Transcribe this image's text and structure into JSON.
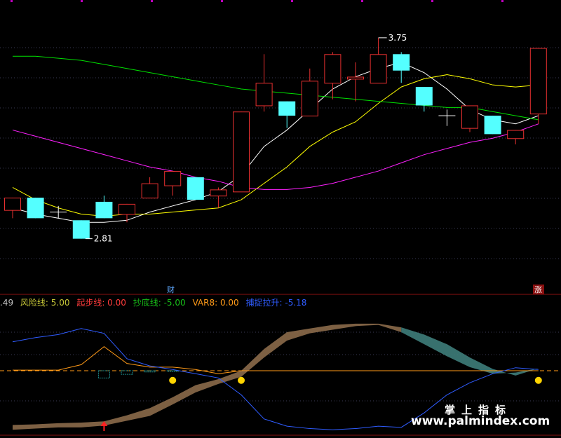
{
  "chart_data": [
    {
      "type": "candlestick",
      "title": "",
      "ylim": [
        2.55,
        3.9
      ],
      "grid": true,
      "annotations": {
        "high_label": "3.75",
        "low_label": "2.81"
      },
      "markers": {
        "cai_label": "财",
        "zhang_label": "涨"
      },
      "candles": [
        {
          "o": 2.97,
          "c": 2.91,
          "h": 2.97,
          "l": 2.87,
          "dir": "up"
        },
        {
          "o": 2.97,
          "c": 2.87,
          "h": 2.97,
          "l": 2.87,
          "dir": "down"
        },
        {
          "o": 2.9,
          "c": 2.9,
          "h": 2.93,
          "l": 2.87,
          "dir": "doji"
        },
        {
          "o": 2.86,
          "c": 2.77,
          "h": 2.86,
          "l": 2.77,
          "dir": "down"
        },
        {
          "o": 2.95,
          "c": 2.87,
          "h": 2.98,
          "l": 2.87,
          "dir": "down"
        },
        {
          "o": 2.89,
          "c": 2.94,
          "h": 2.94,
          "l": 2.85,
          "dir": "up"
        },
        {
          "o": 2.97,
          "c": 3.04,
          "h": 3.07,
          "l": 2.97,
          "dir": "up"
        },
        {
          "o": 3.03,
          "c": 3.1,
          "h": 3.1,
          "l": 2.98,
          "dir": "up"
        },
        {
          "o": 3.07,
          "c": 2.96,
          "h": 3.07,
          "l": 2.96,
          "dir": "down"
        },
        {
          "o": 2.98,
          "c": 3.01,
          "h": 3.02,
          "l": 2.92,
          "dir": "up"
        },
        {
          "o": 3.0,
          "c": 3.39,
          "h": 3.39,
          "l": 3.0,
          "dir": "up"
        },
        {
          "o": 3.42,
          "c": 3.53,
          "h": 3.67,
          "l": 3.39,
          "dir": "up"
        },
        {
          "o": 3.44,
          "c": 3.37,
          "h": 3.44,
          "l": 3.31,
          "dir": "down"
        },
        {
          "o": 3.37,
          "c": 3.54,
          "h": 3.6,
          "l": 3.37,
          "dir": "up"
        },
        {
          "o": 3.53,
          "c": 3.67,
          "h": 3.68,
          "l": 3.45,
          "dir": "up"
        },
        {
          "o": 3.55,
          "c": 3.56,
          "h": 3.63,
          "l": 3.44,
          "dir": "up"
        },
        {
          "o": 3.53,
          "c": 3.67,
          "h": 3.75,
          "l": 3.53,
          "dir": "up"
        },
        {
          "o": 3.67,
          "c": 3.59,
          "h": 3.68,
          "l": 3.53,
          "dir": "down"
        },
        {
          "o": 3.51,
          "c": 3.42,
          "h": 3.51,
          "l": 3.39,
          "dir": "down"
        },
        {
          "o": 3.37,
          "c": 3.37,
          "h": 3.4,
          "l": 3.32,
          "dir": "doji"
        },
        {
          "o": 3.31,
          "c": 3.42,
          "h": 3.42,
          "l": 3.29,
          "dir": "up"
        },
        {
          "o": 3.37,
          "c": 3.28,
          "h": 3.37,
          "l": 3.28,
          "dir": "down"
        },
        {
          "o": 3.26,
          "c": 3.3,
          "h": 3.3,
          "l": 3.23,
          "dir": "up"
        },
        {
          "o": 3.38,
          "c": 3.7,
          "h": 3.7,
          "l": 3.33,
          "dir": "up"
        }
      ],
      "series": [
        {
          "color": "#ffffff",
          "values": [
            2.92,
            2.89,
            2.87,
            2.85,
            2.85,
            2.86,
            2.9,
            2.93,
            2.96,
            3.0,
            3.08,
            3.22,
            3.3,
            3.4,
            3.5,
            3.56,
            3.6,
            3.63,
            3.58,
            3.5,
            3.4,
            3.35,
            3.33,
            3.37
          ]
        },
        {
          "color": "#ffff00",
          "values": [
            3.02,
            2.96,
            2.92,
            2.89,
            2.88,
            2.89,
            2.89,
            2.9,
            2.91,
            2.92,
            2.96,
            3.04,
            3.12,
            3.22,
            3.29,
            3.34,
            3.43,
            3.51,
            3.55,
            3.57,
            3.55,
            3.52,
            3.51,
            3.52
          ]
        },
        {
          "color": "#00e000",
          "values": [
            3.66,
            3.66,
            3.65,
            3.64,
            3.62,
            3.6,
            3.58,
            3.56,
            3.54,
            3.52,
            3.5,
            3.49,
            3.48,
            3.47,
            3.46,
            3.45,
            3.44,
            3.43,
            3.42,
            3.41,
            3.41,
            3.39,
            3.37,
            3.35
          ]
        },
        {
          "color": "#ff20ff",
          "values": [
            3.3,
            3.27,
            3.24,
            3.21,
            3.18,
            3.15,
            3.12,
            3.1,
            3.07,
            3.05,
            3.02,
            3.01,
            3.01,
            3.02,
            3.04,
            3.07,
            3.1,
            3.14,
            3.18,
            3.21,
            3.24,
            3.26,
            3.29,
            3.33
          ]
        }
      ]
    },
    {
      "type": "area",
      "title": "",
      "legend": [
        {
          "text": ".49",
          "color": "#c0c0c0"
        },
        {
          "text": "风险线: 5.00",
          "color": "#c9c938"
        },
        {
          "text": "起步线: 0.00",
          "color": "#ff3b3b"
        },
        {
          "text": "抄底线: -5.00",
          "color": "#18c018"
        },
        {
          "text": "VAR8: 0.00",
          "color": "#ff9a18"
        },
        {
          "text": "捕捉拉升: -5.18",
          "color": "#2f5cff"
        }
      ],
      "ylim": [
        -10,
        10
      ],
      "grid": true,
      "series": [
        {
          "name": "band_upper",
          "color": "#8b6a4a",
          "values": [
            -9.0,
            -8.9,
            -8.7,
            -8.6,
            -8.4,
            -7.4,
            -6.2,
            -4.4,
            -2.4,
            -1.4,
            0.0,
            3.6,
            6.4,
            7.0,
            7.6,
            7.8,
            7.8,
            7.2,
            6.0,
            4.4,
            2.2,
            0.3,
            -0.8,
            0.4
          ]
        },
        {
          "name": "band_lower",
          "color": "#3e7d7a",
          "values": [
            -9.8,
            -9.6,
            -9.4,
            -9.4,
            -9.1,
            -8.3,
            -7.5,
            -5.6,
            -3.6,
            -2.2,
            -1.0,
            2.2,
            5.0,
            6.2,
            6.8,
            7.4,
            7.6,
            6.4,
            4.4,
            2.4,
            0.6,
            -0.5,
            -0.3,
            0.4
          ]
        },
        {
          "name": "",
          "color": "#ff9a18",
          "values": [
            0.1,
            0.1,
            0.1,
            1.0,
            4.0,
            1.2,
            0.6,
            0.6,
            0.2,
            -0.5,
            0.0,
            0.0,
            0.0,
            0.0,
            0.0,
            0.0,
            0.0,
            0.0,
            0.0,
            0.0,
            0.0,
            0.0,
            0.0,
            0.0
          ]
        },
        {
          "name": "",
          "color": "#2f5cff",
          "values": [
            4.8,
            5.5,
            6.0,
            7.0,
            6.2,
            2.0,
            0.8,
            0.2,
            -0.5,
            -1.2,
            -4.0,
            -8.0,
            -9.2,
            -9.6,
            -9.8,
            -9.6,
            -9.2,
            -9.4,
            -7.0,
            -4.0,
            -2.0,
            -0.5,
            0.5,
            0.2
          ]
        }
      ],
      "dash_line_value": 0.0,
      "histogram": [
        0,
        0,
        0,
        0,
        -1.2,
        -0.6,
        -0.2,
        -0.1,
        0,
        0,
        0,
        0,
        0,
        0,
        0,
        0,
        0,
        0,
        0,
        0,
        0,
        0,
        0,
        0
      ],
      "dots": [
        {
          "x": 7,
          "y": -1.6
        },
        {
          "x": 10,
          "y": -1.6
        },
        {
          "x": 23,
          "y": -1.6
        }
      ],
      "arrow": {
        "x": 4,
        "y": -8.6
      }
    }
  ],
  "watermark": {
    "cn": "掌上指标",
    "url": "www.palmindex.com"
  }
}
